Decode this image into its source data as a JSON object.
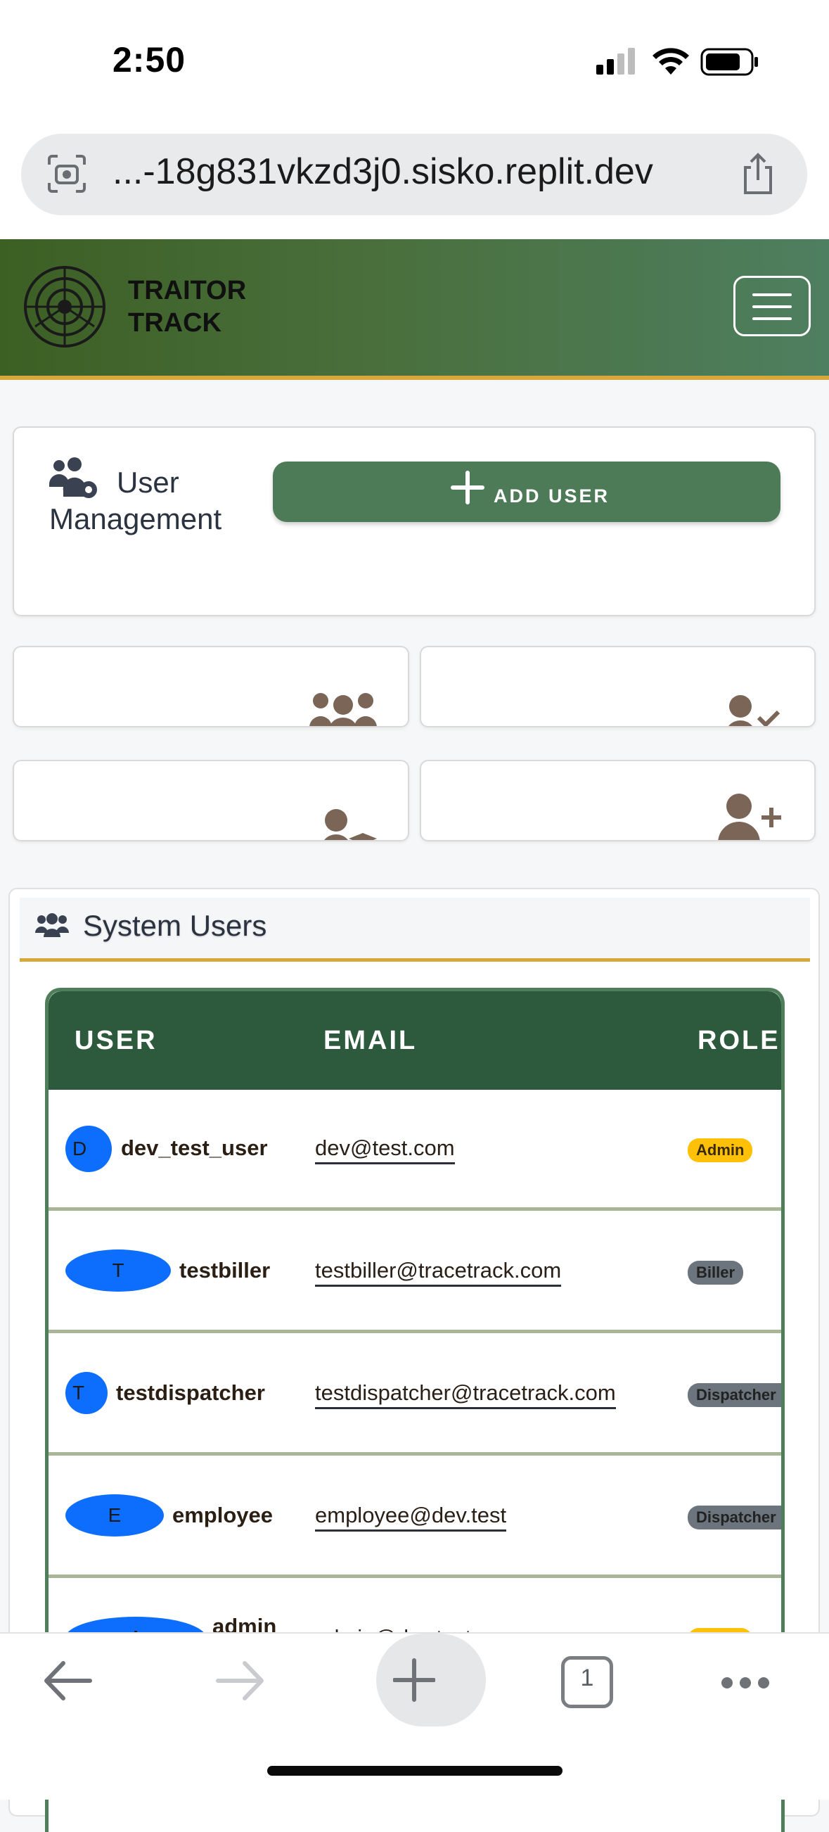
{
  "status_bar": {
    "time": "2:50"
  },
  "browser": {
    "url": "...-18g831vkzd3j0.sisko.replit.dev",
    "tab_count": "1"
  },
  "nav": {
    "brand_line1": "TRAITOR",
    "brand_line2": "TRACK"
  },
  "user_management": {
    "title": "User Management",
    "add_button": "ADD USER"
  },
  "system_users": {
    "title": "System Users",
    "columns": [
      "USER",
      "EMAIL",
      "ROLE"
    ],
    "rows": [
      {
        "initial": "D",
        "username": "dev_test_user",
        "email": "dev@test.com",
        "role": "Admin"
      },
      {
        "initial": "T",
        "username": "testbiller",
        "email": "testbiller@tracetrack.com",
        "role": "Biller"
      },
      {
        "initial": "T",
        "username": "testdispatcher",
        "email": "testdispatcher@tracetrack.com",
        "role": "Dispatcher"
      },
      {
        "initial": "E",
        "username": "employee",
        "email": "employee@dev.test",
        "role": "Dispatcher"
      },
      {
        "initial": "A",
        "username": "admin",
        "email": "admin@dev.test",
        "role": "Admin"
      }
    ]
  },
  "colors": {
    "nav_gradient_start": "#3c5f24",
    "nav_gradient_end": "#4e7f60",
    "accent_gold": "#d9a83a",
    "add_button": "#4d7b57",
    "table_header": "#2d5a3c",
    "avatar": "#0d6efd",
    "badge_admin": "#ffc107",
    "badge_other": "#6c757d"
  },
  "icons": {
    "stat1": "users-icon",
    "stat2": "user-check-icon",
    "stat3": "user-graduate-icon",
    "stat4": "user-plus-icon"
  }
}
